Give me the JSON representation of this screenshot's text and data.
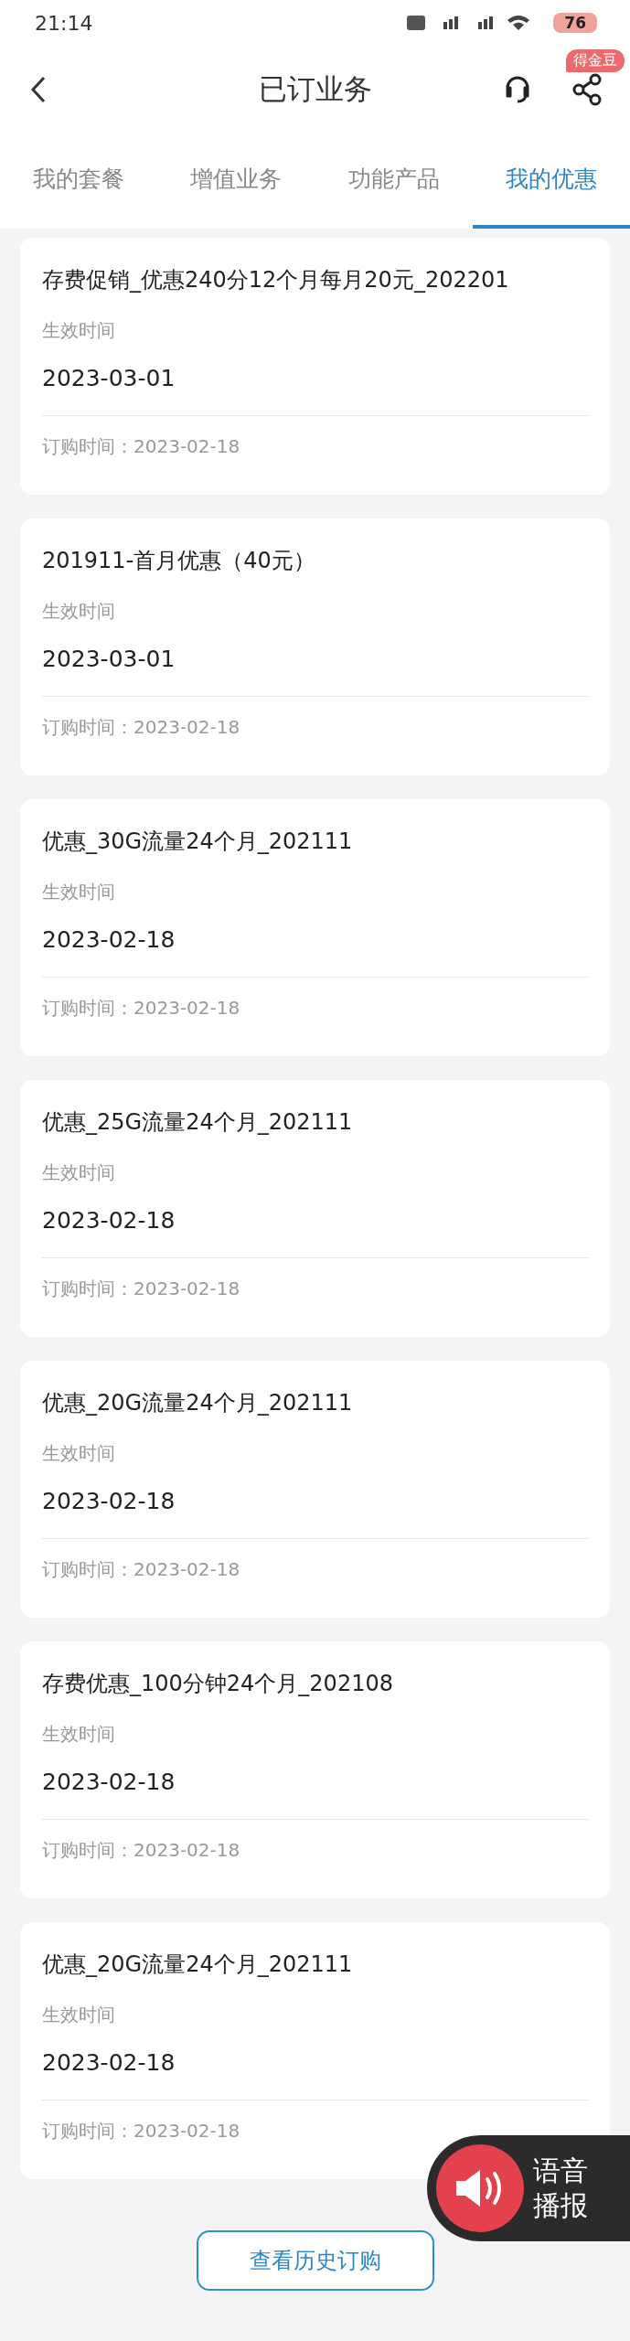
{
  "status_bar": {
    "time": "21:14",
    "battery": "76"
  },
  "header": {
    "title": "已订业务",
    "badge": "得金豆"
  },
  "tabs": [
    {
      "label": "我的套餐",
      "selected": false
    },
    {
      "label": "增值业务",
      "selected": false
    },
    {
      "label": "功能产品",
      "selected": false
    },
    {
      "label": "我的优惠",
      "selected": true
    }
  ],
  "offers": [
    {
      "name": "存费促销_优惠240分12个月每月20元_202201",
      "effective_label": "生效时间",
      "effective_date": "2023-03-01",
      "order_time": "订购时间：2023-02-18"
    },
    {
      "name": "201911-首月优惠（40元）",
      "effective_label": "生效时间",
      "effective_date": "2023-03-01",
      "order_time": "订购时间：2023-02-18"
    },
    {
      "name": "优惠_30G流量24个月_202111",
      "effective_label": "生效时间",
      "effective_date": "2023-02-18",
      "order_time": "订购时间：2023-02-18"
    },
    {
      "name": "优惠_25G流量24个月_202111",
      "effective_label": "生效时间",
      "effective_date": "2023-02-18",
      "order_time": "订购时间：2023-02-18"
    },
    {
      "name": "优惠_20G流量24个月_202111",
      "effective_label": "生效时间",
      "effective_date": "2023-02-18",
      "order_time": "订购时间：2023-02-18"
    },
    {
      "name": "存费优惠_100分钟24个月_202108",
      "effective_label": "生效时间",
      "effective_date": "2023-02-18",
      "order_time": "订购时间：2023-02-18"
    },
    {
      "name": "优惠_20G流量24个月_202111",
      "effective_label": "生效时间",
      "effective_date": "2023-02-18",
      "order_time": "订购时间：2023-02-18"
    }
  ],
  "history_button": "查看历史订购",
  "voice_widget": {
    "line_1": "语音",
    "line_2": "播报"
  }
}
